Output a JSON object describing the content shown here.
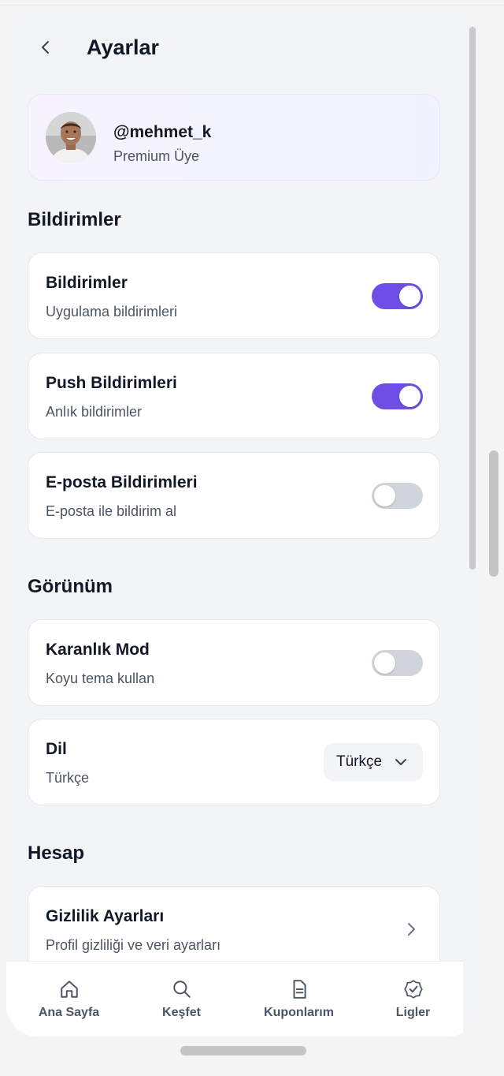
{
  "header": {
    "title": "Ayarlar"
  },
  "profile": {
    "username": "@mehmet_k",
    "membership": "Premium Üye"
  },
  "sections": {
    "notifications": {
      "title": "Bildirimler",
      "items": [
        {
          "title": "Bildirimler",
          "subtitle": "Uygulama bildirimleri",
          "enabled": true
        },
        {
          "title": "Push Bildirimleri",
          "subtitle": "Anlık bildirimler",
          "enabled": true
        },
        {
          "title": "E-posta Bildirimleri",
          "subtitle": "E-posta ile bildirim al",
          "enabled": false
        }
      ]
    },
    "appearance": {
      "title": "Görünüm",
      "dark_mode": {
        "title": "Karanlık Mod",
        "subtitle": "Koyu tema kullan",
        "enabled": false
      },
      "language": {
        "title": "Dil",
        "subtitle": "Türkçe",
        "selected": "Türkçe"
      }
    },
    "account": {
      "title": "Hesap",
      "privacy": {
        "title": "Gizlilik Ayarları",
        "subtitle": "Profil gizliliği ve veri ayarları"
      }
    }
  },
  "bottom_nav": [
    {
      "label": "Ana Sayfa",
      "icon": "home-icon"
    },
    {
      "label": "Keşfet",
      "icon": "search-icon"
    },
    {
      "label": "Kuponlarım",
      "icon": "document-icon"
    },
    {
      "label": "Ligler",
      "icon": "badge-check-icon"
    }
  ],
  "colors": {
    "accent": "#6d4ee6",
    "toggle_off": "#d1d5db",
    "background": "#f3f4f6",
    "text": "#111827"
  }
}
